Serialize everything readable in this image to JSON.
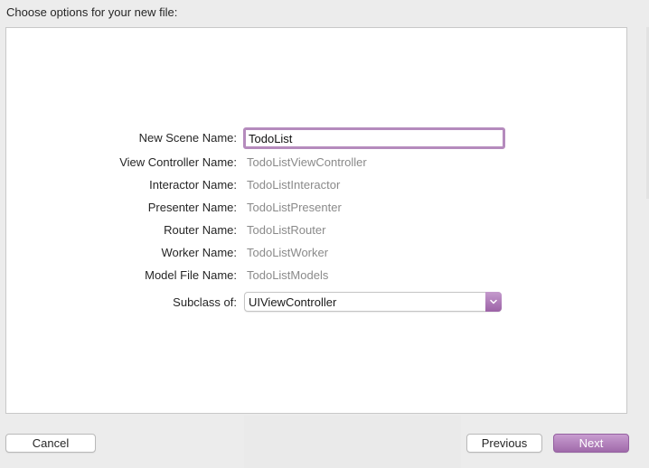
{
  "dialog": {
    "heading": "Choose options for your new file:"
  },
  "form": {
    "scene_name": {
      "label": "New Scene Name:",
      "value": "TodoList"
    },
    "derived": [
      {
        "label": "View Controller Name:",
        "value": "TodoListViewController"
      },
      {
        "label": "Interactor Name:",
        "value": "TodoListInteractor"
      },
      {
        "label": "Presenter Name:",
        "value": "TodoListPresenter"
      },
      {
        "label": "Router Name:",
        "value": "TodoListRouter"
      },
      {
        "label": "Worker Name:",
        "value": "TodoListWorker"
      },
      {
        "label": "Model File Name:",
        "value": "TodoListModels"
      }
    ],
    "subclass": {
      "label": "Subclass of:",
      "value": "UIViewController"
    }
  },
  "buttons": {
    "cancel": "Cancel",
    "previous": "Previous",
    "next": "Next"
  },
  "colors": {
    "accent": "#a06aaa",
    "focus_ring": "#b58bbd",
    "panel_bg": "#ffffff",
    "window_bg": "#ececec"
  },
  "icons": {
    "popup_arrow": "chevron-down-icon"
  }
}
